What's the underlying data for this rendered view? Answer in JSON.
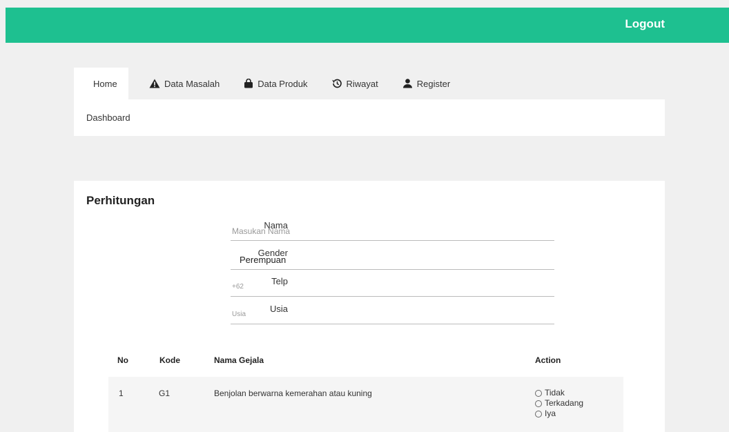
{
  "header": {
    "logout_label": "Logout"
  },
  "tabs": [
    {
      "label": "Home",
      "icon": "home-icon"
    },
    {
      "label": "Data Masalah",
      "icon": "warning-icon"
    },
    {
      "label": "Data Produk",
      "icon": "bag-icon"
    },
    {
      "label": "Riwayat",
      "icon": "history-icon"
    },
    {
      "label": "Register",
      "icon": "user-icon"
    }
  ],
  "dashboard": {
    "label": "Dashboard"
  },
  "form": {
    "title": "Perhitungan",
    "fields": [
      {
        "label": "Nama",
        "placeholder": "Masukan Nama"
      },
      {
        "label": "Gender",
        "value": "Perempuan"
      },
      {
        "label": "Telp",
        "placeholder": "+62"
      },
      {
        "label": "Usia",
        "placeholder": "Usia"
      }
    ]
  },
  "table": {
    "headers": [
      "No",
      "Kode",
      "Nama Gejala",
      "Action"
    ],
    "rows": [
      {
        "no": "1",
        "kode": "G1",
        "gejala": "Benjolan berwarna kemerahan atau kuning",
        "options": [
          "Tidak",
          "Terkadang",
          "Iya"
        ]
      }
    ]
  },
  "colors": {
    "accent": "#1ec090",
    "background": "#f0f0f0"
  }
}
